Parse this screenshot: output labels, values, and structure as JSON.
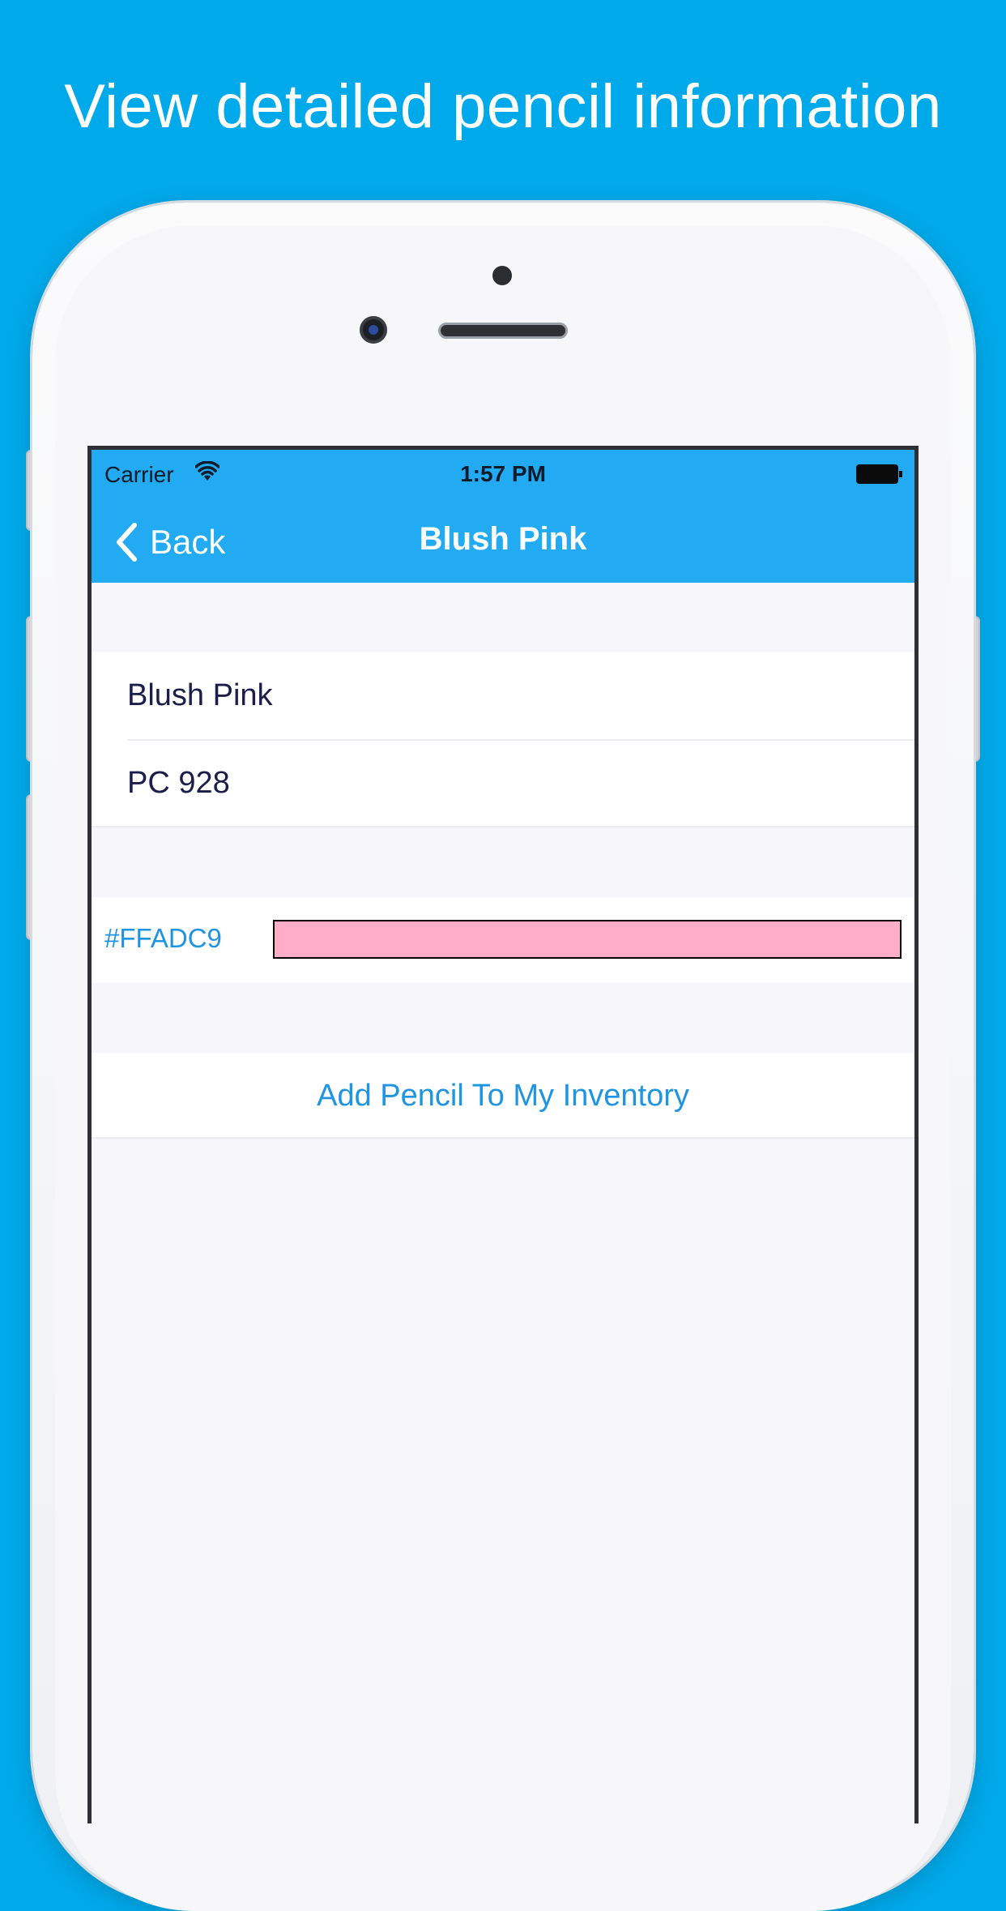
{
  "headline": "View detailed pencil information",
  "status_bar": {
    "carrier": "Carrier",
    "time": "1:57 PM"
  },
  "nav": {
    "back_label": "Back",
    "title": "Blush Pink"
  },
  "details": {
    "name": "Blush Pink",
    "code": "PC 928"
  },
  "color": {
    "hex_label": "#FFADC9",
    "swatch_color": "#FFADC9"
  },
  "actions": {
    "add_label": "Add Pencil To My Inventory"
  },
  "theme": {
    "background": "#00a9ea",
    "navbar": "#22aaf2",
    "accent_text": "#1f95e2",
    "cell_text": "#1b1d4a"
  }
}
